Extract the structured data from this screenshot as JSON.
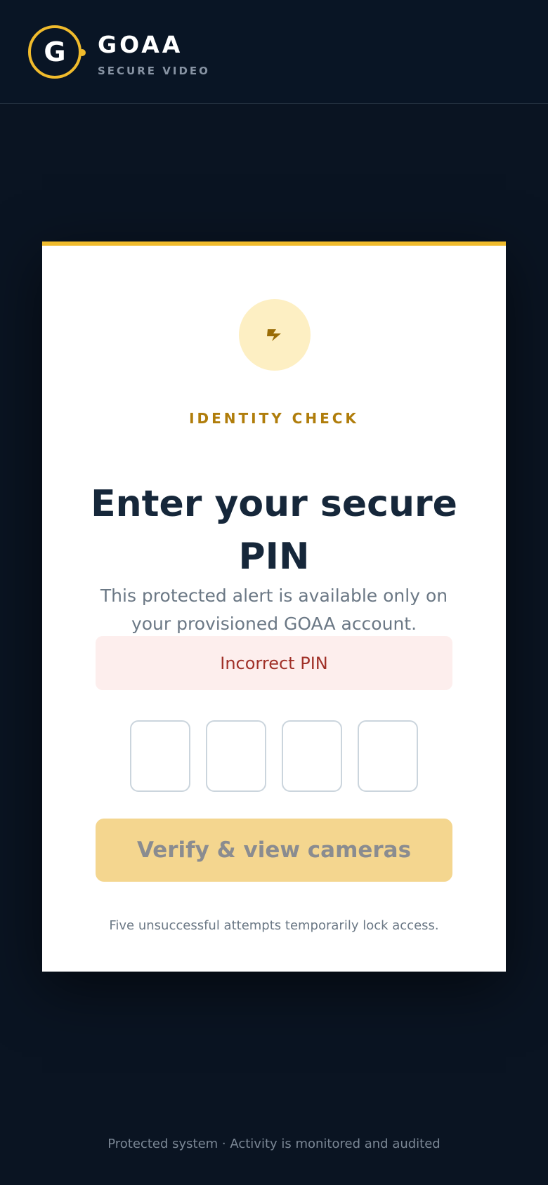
{
  "header": {
    "logo_letter": "G",
    "brand_name": "GOAA",
    "brand_tagline": "SECURE VIDEO"
  },
  "card": {
    "badge_icon": "lightning-bolt-icon",
    "eyebrow": "IDENTITY CHECK",
    "title": "Enter your secure PIN",
    "subtitle": "This protected alert is available only on your provisioned GOAA account.",
    "error_message": "Incorrect PIN",
    "pin_digits": [
      "",
      "",
      "",
      ""
    ],
    "verify_button_label": "Verify & view cameras",
    "lock_note": "Five unsuccessful attempts temporarily lock access."
  },
  "footer": {
    "notice": "Protected system · Activity is monitored and audited"
  },
  "colors": {
    "page_background": "#0a1422",
    "accent": "#f0bb2c",
    "title_text": "#16273a",
    "error_background": "#fdeeed",
    "error_text": "#a03028",
    "button_disabled": "#f4d68f"
  }
}
